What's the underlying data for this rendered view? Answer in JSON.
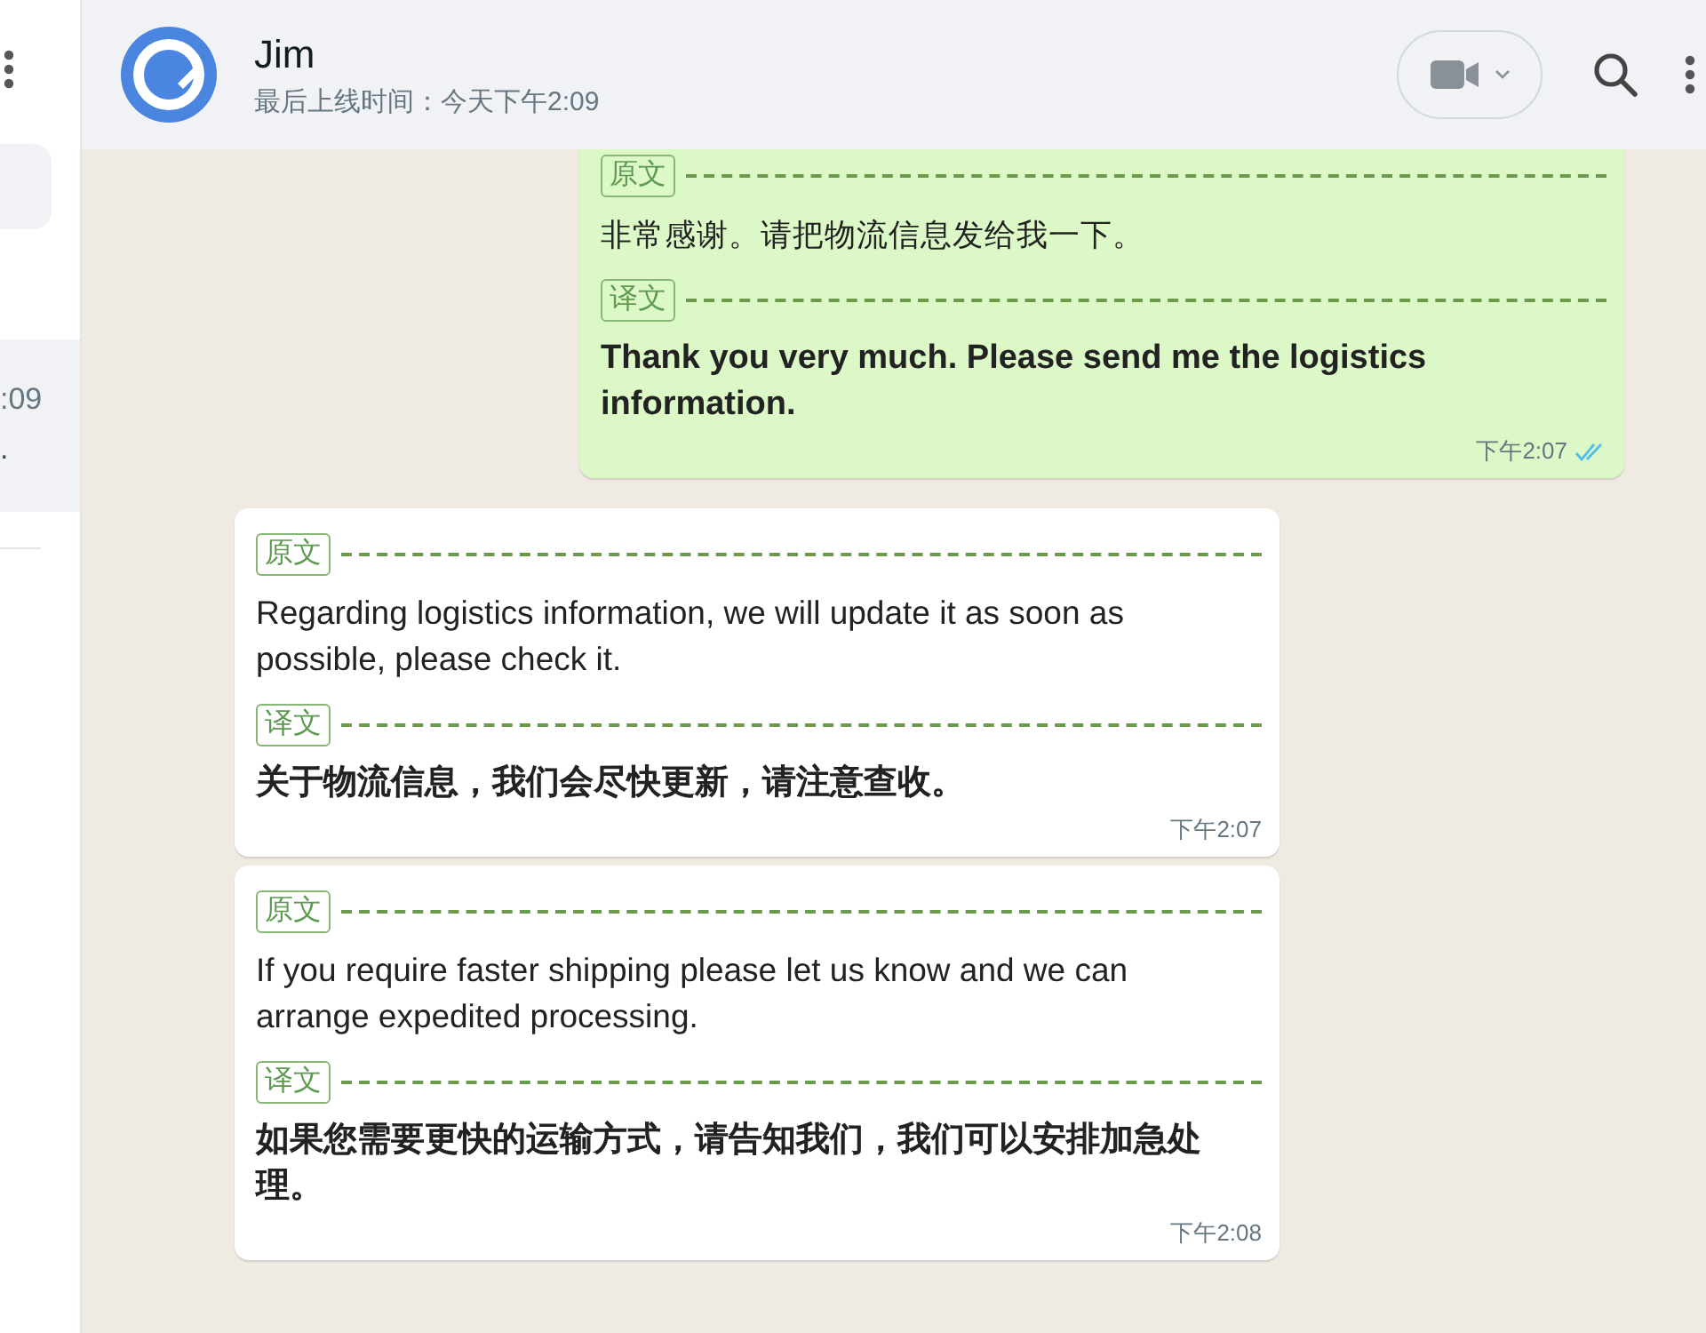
{
  "sidebar": {
    "chats": [
      {
        "time": ":09",
        "preview": ".",
        "selected": true
      }
    ]
  },
  "header": {
    "name": "Jim",
    "status": "最后上线时间：今天下午2:09"
  },
  "messages": [
    {
      "kind": "outgoing",
      "original_label": "原文",
      "original": "非常感谢。请把物流信息发给我一下。",
      "translation_label": "译文",
      "translation": "Thank you very much. Please send me the logistics information.",
      "time": "下午2:07",
      "read": true
    },
    {
      "kind": "incoming",
      "original_label": "原文",
      "original": "Regarding logistics information, we will update it as soon as possible, please check it.",
      "translation_label": "译文",
      "translation": "关于物流信息，我们会尽快更新，请注意查收。",
      "time": "下午2:07"
    },
    {
      "kind": "incoming",
      "original_label": "原文",
      "original": "If you require faster shipping please let us know and we can arrange expedited processing.",
      "translation_label": "译文",
      "translation": "如果您需要更快的运输方式，请告知我们，我们可以安排加急处理。",
      "time": "下午2:08"
    }
  ]
}
